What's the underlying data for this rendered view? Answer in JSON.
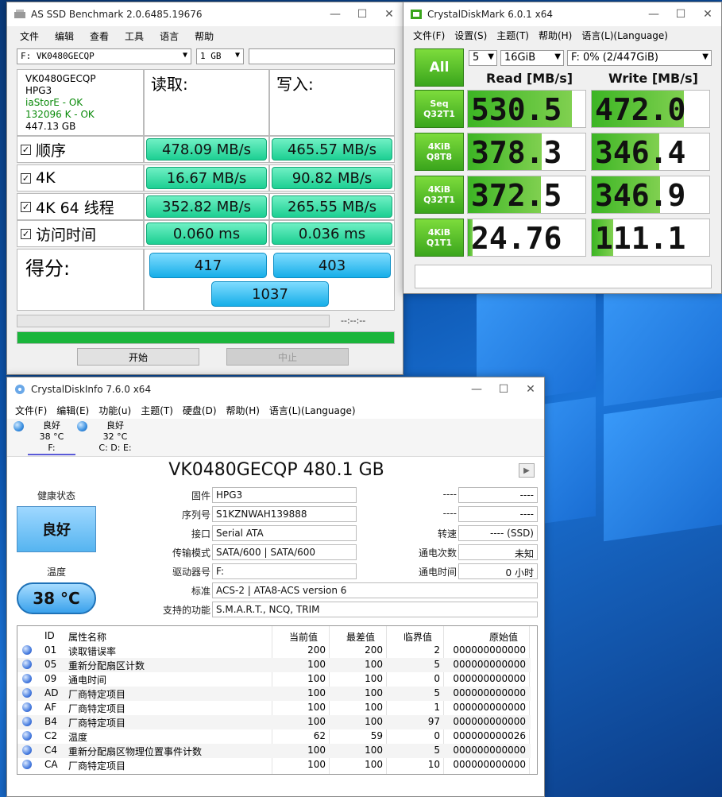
{
  "asssd": {
    "title": "AS SSD Benchmark 2.0.6485.19676",
    "menu": [
      "文件",
      "编辑",
      "查看",
      "工具",
      "语言",
      "帮助"
    ],
    "drive_select": "F: VK0480GECQP",
    "size_select": "1 GB",
    "info": {
      "model": "VK0480GECQP",
      "firmware": "HPG3",
      "driver": "iaStorE - OK",
      "align": "132096 K - OK",
      "capacity": "447.13 GB"
    },
    "read_header": "读取:",
    "write_header": "写入:",
    "rows": [
      {
        "label": "顺序",
        "read": "478.09 MB/s",
        "write": "465.57 MB/s"
      },
      {
        "label": "4K",
        "read": "16.67 MB/s",
        "write": "90.82 MB/s"
      },
      {
        "label": "4K 64 线程",
        "read": "352.82 MB/s",
        "write": "265.55 MB/s"
      },
      {
        "label": "访问时间",
        "read": "0.060 ms",
        "write": "0.036 ms"
      }
    ],
    "score_label": "得分:",
    "score_read": "417",
    "score_write": "403",
    "score_total": "1037",
    "elapsed": "--:--:--",
    "progress_pct": 100,
    "start_button": "开始",
    "stop_button": "中止"
  },
  "cdm": {
    "title": "CrystalDiskMark 6.0.1 x64",
    "menu": [
      "文件(F)",
      "设置(S)",
      "主题(T)",
      "帮助(H)",
      "语言(L)(Language)"
    ],
    "all_button": "All",
    "count": "5",
    "size": "16GiB",
    "drive": "F: 0% (2/447GiB)",
    "read_header": "Read [MB/s]",
    "write_header": "Write [MB/s]",
    "max_scale": 600,
    "rows": [
      {
        "line1": "Seq",
        "line2": "Q32T1",
        "read": "530.5",
        "write": "472.0",
        "read_v": 530.5,
        "write_v": 472.0
      },
      {
        "line1": "4KiB",
        "line2": "Q8T8",
        "read": "378.3",
        "write": "346.4",
        "read_v": 378.3,
        "write_v": 346.4
      },
      {
        "line1": "4KiB",
        "line2": "Q32T1",
        "read": "372.5",
        "write": "346.9",
        "read_v": 372.5,
        "write_v": 346.9
      },
      {
        "line1": "4KiB",
        "line2": "Q1T1",
        "read": "24.76",
        "write": "111.1",
        "read_v": 24.76,
        "write_v": 111.1
      }
    ]
  },
  "cdi": {
    "title": "CrystalDiskInfo 7.6.0 x64",
    "menu": [
      "文件(F)",
      "编辑(E)",
      "功能(u)",
      "主题(T)",
      "硬盘(D)",
      "帮助(H)",
      "语言(L)(Language)"
    ],
    "disks": [
      {
        "status": "良好",
        "temp": "38 °C",
        "letters": "F:"
      },
      {
        "status": "良好",
        "temp": "32 °C",
        "letters": "C: D: E:"
      }
    ],
    "drive_title": "VK0480GECQP 480.1 GB",
    "health_label": "健康状态",
    "health_value": "良好",
    "temp_label": "温度",
    "temp_value": "38 °C",
    "firmware_label": "固件",
    "firmware": "HPG3",
    "serial_label": "序列号",
    "serial": "S1KZNWAH139888",
    "interface_label": "接口",
    "interface": "Serial ATA",
    "transfer_label": "传输模式",
    "transfer": "SATA/600 | SATA/600",
    "letter_label": "驱动器号",
    "letter": "F:",
    "standard_label": "标准",
    "standard": "ACS-2 | ATA8-ACS version 6",
    "features_label": "支持的功能",
    "features": "S.M.A.R.T., NCQ, TRIM",
    "r1_label": "----",
    "r1_value": "----",
    "r2_label": "----",
    "r2_value": "----",
    "rotation_label": "转速",
    "rotation": "---- (SSD)",
    "power_count_label": "通电次数",
    "power_count": "未知",
    "power_hours_label": "通电时间",
    "power_hours": "0 小时",
    "table_headers": [
      "ID",
      "属性名称",
      "当前值",
      "最差值",
      "临界值",
      "原始值"
    ],
    "smart": [
      {
        "id": "01",
        "name": "读取错误率",
        "cur": "200",
        "worst": "200",
        "thr": "2",
        "raw": "000000000000"
      },
      {
        "id": "05",
        "name": "重新分配扇区计数",
        "cur": "100",
        "worst": "100",
        "thr": "5",
        "raw": "000000000000"
      },
      {
        "id": "09",
        "name": "通电时间",
        "cur": "100",
        "worst": "100",
        "thr": "0",
        "raw": "000000000000"
      },
      {
        "id": "AD",
        "name": "厂商特定项目",
        "cur": "100",
        "worst": "100",
        "thr": "5",
        "raw": "000000000000"
      },
      {
        "id": "AF",
        "name": "厂商特定项目",
        "cur": "100",
        "worst": "100",
        "thr": "1",
        "raw": "000000000000"
      },
      {
        "id": "B4",
        "name": "厂商特定项目",
        "cur": "100",
        "worst": "100",
        "thr": "97",
        "raw": "000000000000"
      },
      {
        "id": "C2",
        "name": "温度",
        "cur": "62",
        "worst": "59",
        "thr": "0",
        "raw": "000000000026"
      },
      {
        "id": "C4",
        "name": "重新分配扇区物理位置事件计数",
        "cur": "100",
        "worst": "100",
        "thr": "5",
        "raw": "000000000000"
      },
      {
        "id": "CA",
        "name": "厂商特定项目",
        "cur": "100",
        "worst": "100",
        "thr": "10",
        "raw": "000000000000"
      }
    ]
  }
}
